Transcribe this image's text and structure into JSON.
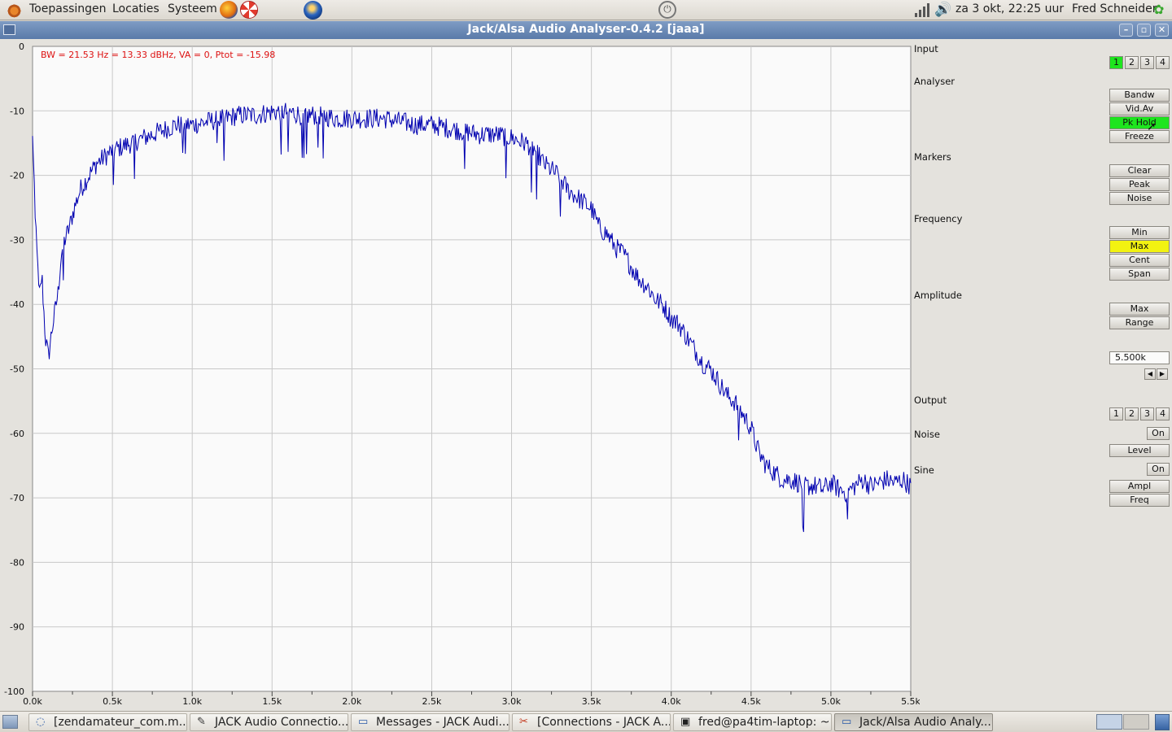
{
  "top_panel": {
    "menus": [
      "Toepassingen",
      "Locaties",
      "Systeem"
    ],
    "clock": "za  3 okt, 22:25 uur",
    "user": "Fred Schneider"
  },
  "window": {
    "title": "Jack/Alsa Audio Analyser-0.4.2  [jaaa]"
  },
  "plot": {
    "info": "BW = 21.53 Hz = 13.33 dBHz, VA = 0, Ptot = -15.98",
    "trace_color": "#0000b0",
    "info_color": "#dd1111"
  },
  "chart_data": {
    "type": "line",
    "title": "",
    "xlabel": "",
    "ylabel": "",
    "xlim": [
      0,
      5500
    ],
    "ylim": [
      -100,
      0
    ],
    "grid": true,
    "x_ticks": [
      "0.0k",
      "0.5k",
      "1.0k",
      "1.5k",
      "2.0k",
      "2.5k",
      "3.0k",
      "3.5k",
      "4.0k",
      "4.5k",
      "5.0k",
      "5.5k"
    ],
    "y_ticks": [
      "0",
      "-10",
      "-20",
      "-30",
      "-40",
      "-50",
      "-60",
      "-70",
      "-80",
      "-90",
      "-100"
    ],
    "series": [
      {
        "x": [
          0,
          20,
          40,
          60,
          80,
          100,
          120,
          140,
          160,
          180,
          200,
          230,
          260,
          300,
          350,
          400,
          450,
          500,
          600,
          700,
          800,
          900,
          1000,
          1100,
          1200,
          1300,
          1400,
          1500,
          1600,
          1700,
          1800,
          1900,
          2000,
          2100,
          2200,
          2300,
          2400,
          2500,
          2600,
          2700,
          2800,
          2900,
          3000,
          3050,
          3100,
          3150,
          3200,
          3250,
          3300,
          3350,
          3400,
          3450,
          3500,
          3550,
          3600,
          3650,
          3700,
          3750,
          3800,
          3850,
          3900,
          3950,
          4000,
          4050,
          4100,
          4150,
          4200,
          4250,
          4300,
          4350,
          4400,
          4450,
          4500,
          4550,
          4600,
          4650,
          4700,
          4750,
          4800,
          4850,
          4900,
          4950,
          5000,
          5050,
          5100,
          5150,
          5200,
          5250,
          5300,
          5350,
          5400,
          5450,
          5500
        ],
        "y": [
          -14,
          -27,
          -38,
          -36,
          -45,
          -48,
          -44,
          -41,
          -38,
          -32,
          -30,
          -28,
          -25,
          -22,
          -20,
          -18,
          -17,
          -16,
          -15,
          -14,
          -13,
          -12,
          -12,
          -11.5,
          -11,
          -10.5,
          -10.5,
          -10,
          -10,
          -10.5,
          -10.5,
          -11,
          -11,
          -11,
          -11,
          -11.5,
          -12,
          -12,
          -12.5,
          -13,
          -13.5,
          -13.5,
          -14,
          -14.5,
          -15,
          -16,
          -18,
          -19,
          -20,
          -22,
          -23,
          -24,
          -25,
          -28,
          -29,
          -31,
          -32,
          -34,
          -36,
          -37,
          -39,
          -40,
          -42,
          -43,
          -45,
          -47,
          -49,
          -50,
          -52,
          -54,
          -55,
          -57,
          -59,
          -63,
          -65,
          -66,
          -67,
          -67,
          -67.5,
          -68,
          -68,
          -68.5,
          -67.5,
          -68.5,
          -69,
          -68,
          -67,
          -68,
          -67.5,
          -67,
          -67.5,
          -67,
          -68
        ]
      }
    ]
  },
  "side": {
    "input_label": "Input",
    "input_channels": [
      "1",
      "2",
      "3",
      "4"
    ],
    "analyser_label": "Analyser",
    "analyser_buttons": [
      "Bandw",
      "Vid.Av",
      "Pk Hold",
      "Freeze"
    ],
    "markers_label": "Markers",
    "markers_buttons": [
      "Clear",
      "Peak",
      "Noise"
    ],
    "frequency_label": "Frequency",
    "frequency_buttons": [
      "Min",
      "Max",
      "Cent",
      "Span"
    ],
    "amplitude_label": "Amplitude",
    "amplitude_buttons": [
      "Max",
      "Range"
    ],
    "value": "5.500k",
    "output_label": "Output",
    "output_channels": [
      "1",
      "2",
      "3",
      "4"
    ],
    "noise_label": "Noise",
    "noise_on": "On",
    "noise_level": "Level",
    "sine_label": "Sine",
    "sine_on": "On",
    "sine_buttons": [
      "Ampl",
      "Freq"
    ],
    "active_green": "#1ee51e",
    "active_yellow": "#f2f211"
  },
  "taskbar": {
    "items": [
      {
        "label": "[zendamateur_com.m...",
        "icon": "browser-icon"
      },
      {
        "label": "JACK Audio Connectio...",
        "icon": "jack-icon"
      },
      {
        "label": "Messages - JACK Audi...",
        "icon": "window-icon"
      },
      {
        "label": "[Connections - JACK A...",
        "icon": "connections-icon"
      },
      {
        "label": "fred@pa4tim-laptop: ~",
        "icon": "terminal-icon"
      },
      {
        "label": "Jack/Alsa Audio Analy...",
        "icon": "window-icon"
      }
    ]
  }
}
